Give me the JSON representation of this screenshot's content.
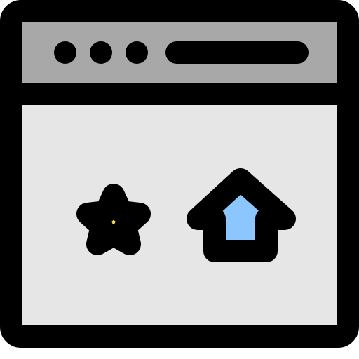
{
  "icon": {
    "name": "browser-window-favorites-home-icon",
    "colors": {
      "outline": "#000000",
      "title_bar": "#a8a8a8",
      "content": "#e6e6e6",
      "star_fill": "#f3dd4e",
      "house_fill": "#8cc6ff"
    },
    "title_bar": {
      "window_control_dots": 3,
      "address_bar": "address-bar-pill"
    },
    "content_icons": [
      "star-icon",
      "home-icon"
    ]
  }
}
